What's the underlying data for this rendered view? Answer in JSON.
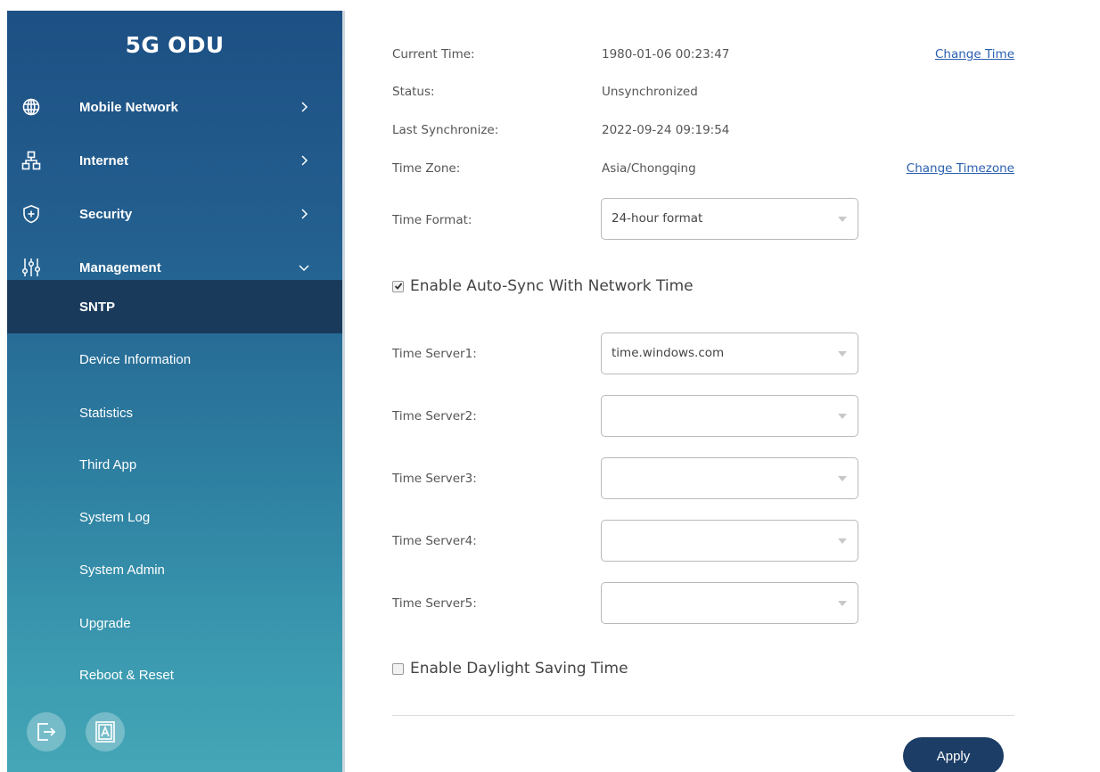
{
  "brand": "5G ODU",
  "sidebar": {
    "nav": [
      {
        "label": "Mobile Network",
        "icon": "globe-icon",
        "expanded": false
      },
      {
        "label": "Internet",
        "icon": "network-icon",
        "expanded": false
      },
      {
        "label": "Security",
        "icon": "shield-plus-icon",
        "expanded": false
      },
      {
        "label": "Management",
        "icon": "sliders-icon",
        "expanded": true
      }
    ],
    "sub_items": [
      {
        "label": "SNTP",
        "active": true
      },
      {
        "label": "Device Information"
      },
      {
        "label": "Statistics"
      },
      {
        "label": "Third App"
      },
      {
        "label": "System Log"
      },
      {
        "label": "System Admin"
      },
      {
        "label": "Upgrade"
      },
      {
        "label": "Reboot & Reset"
      }
    ],
    "bottom_buttons": [
      {
        "icon": "logout-icon"
      },
      {
        "icon": "font-size-icon"
      }
    ]
  },
  "main": {
    "current_time": {
      "label": "Current Time:",
      "value": "1980-01-06 00:23:47",
      "link": "Change Time"
    },
    "status": {
      "label": "Status:",
      "value": "Unsynchronized"
    },
    "last_sync": {
      "label": "Last Synchronize:",
      "value": "2022-09-24 09:19:54"
    },
    "time_zone": {
      "label": "Time Zone:",
      "value": "Asia/Chongqing",
      "link": "Change Timezone"
    },
    "time_format": {
      "label": "Time Format:",
      "value": "24-hour format"
    },
    "auto_sync": {
      "label": "Enable Auto-Sync With Network Time",
      "checked": true
    },
    "servers": [
      {
        "label": "Time Server1:",
        "value": "time.windows.com"
      },
      {
        "label": "Time Server2:",
        "value": ""
      },
      {
        "label": "Time Server3:",
        "value": ""
      },
      {
        "label": "Time Server4:",
        "value": ""
      },
      {
        "label": "Time Server5:",
        "value": ""
      }
    ],
    "daylight": {
      "label": "Enable Daylight Saving Time",
      "checked": false
    },
    "apply_label": "Apply"
  },
  "colors": {
    "sidebar_top": "#1d5084",
    "sidebar_bottom": "#44a6b6",
    "active_item": "#1a3a5c",
    "link": "#2a5fb0",
    "apply_button": "#1b3d66"
  }
}
